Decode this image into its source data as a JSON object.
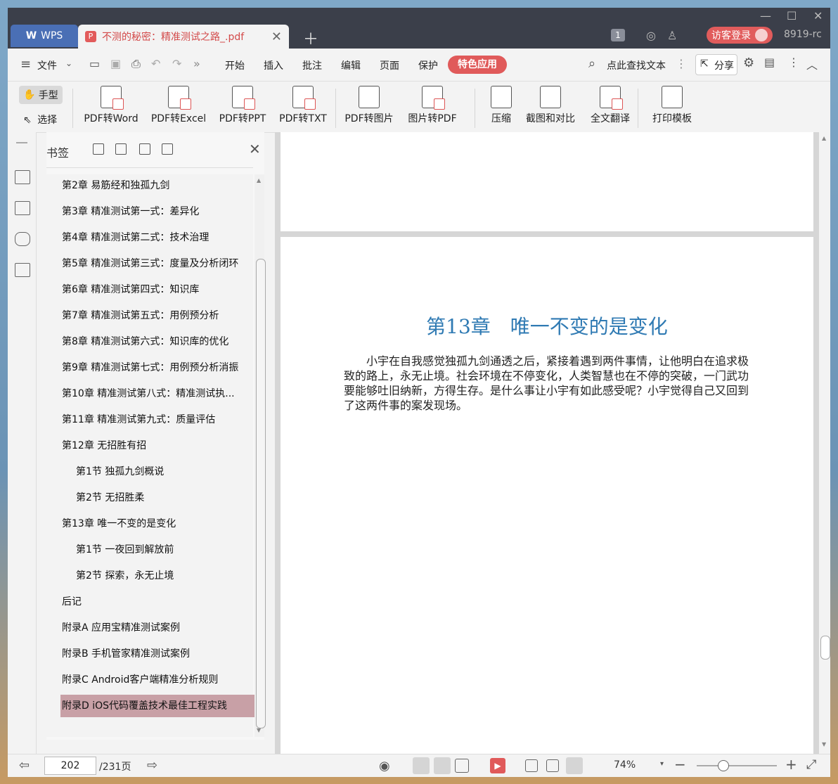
{
  "titlebar": {
    "app_label": "WPS",
    "doc_tab_title": "不测的秘密：精准测试之路_.pdf",
    "page_badge": "1",
    "login_label": "访客登录",
    "version": "8919-rc"
  },
  "menu": {
    "file": "文件",
    "items": [
      "开始",
      "插入",
      "批注",
      "编辑",
      "页面",
      "保护"
    ],
    "special": "特色应用",
    "find": "点此查找文本",
    "share": "分享"
  },
  "ribbon": {
    "hand": "手型",
    "select": "选择",
    "buttons": [
      "PDF转Word",
      "PDF转Excel",
      "PDF转PPT",
      "PDF转TXT",
      "PDF转图片",
      "图片转PDF",
      "压缩",
      "截图和对比",
      "全文翻译",
      "打印模板"
    ]
  },
  "bookmarks": {
    "title": "书签",
    "items": [
      {
        "label": "第2章 易筋经和独孤九剑",
        "level": 1,
        "arrow": "▸"
      },
      {
        "label": "第3章 精准测试第一式：差异化",
        "level": 1,
        "arrow": "▸"
      },
      {
        "label": "第4章 精准测试第二式：技术治理",
        "level": 1,
        "arrow": "▸"
      },
      {
        "label": "第5章 精准测试第三式：度量及分析闭环",
        "level": 1,
        "arrow": "▸"
      },
      {
        "label": "第6章 精准测试第四式：知识库",
        "level": 1,
        "arrow": "▸"
      },
      {
        "label": "第7章 精准测试第五式：用例预分析",
        "level": 1,
        "arrow": "▸"
      },
      {
        "label": "第8章 精准测试第六式：知识库的优化",
        "level": 1,
        "arrow": "▸"
      },
      {
        "label": "第9章 精准测试第七式：用例预分析消振",
        "level": 1,
        "arrow": "▸"
      },
      {
        "label": "第10章 精准测试第八式：精准测试执...",
        "level": 1,
        "arrow": "▸"
      },
      {
        "label": "第11章 精准测试第九式：质量评估",
        "level": 1,
        "arrow": "▸"
      },
      {
        "label": "第12章 无招胜有招",
        "level": 1,
        "arrow": "▴"
      },
      {
        "label": "第1节 独孤九剑概说",
        "level": 2,
        "arrow": ""
      },
      {
        "label": "第2节 无招胜柔",
        "level": 2,
        "arrow": ""
      },
      {
        "label": "第13章 唯一不变的是变化",
        "level": 1,
        "arrow": "▴"
      },
      {
        "label": "第1节 一夜回到解放前",
        "level": 2,
        "arrow": ""
      },
      {
        "label": "第2节 探索，永无止境",
        "level": 2,
        "arrow": ""
      },
      {
        "label": "后记",
        "level": 1,
        "arrow": ""
      },
      {
        "label": "附录A 应用宝精准测试案例",
        "level": 1,
        "arrow": ""
      },
      {
        "label": "附录B 手机管家精准测试案例",
        "level": 1,
        "arrow": ""
      },
      {
        "label": "附录C Android客户端精准分析规则",
        "level": 1,
        "arrow": ""
      },
      {
        "label": "附录D iOS代码覆盖技术最佳工程实践",
        "level": 1,
        "arrow": "",
        "selected": true
      }
    ]
  },
  "document": {
    "chapter_title": "第13章　唯一不变的是变化",
    "paragraph": "小宇在自我感觉独孤九剑通透之后，紧接着遇到两件事情，让他明白在追求极致的路上，永无止境。社会环境在不停变化，人类智慧也在不停的突破，一门武功要能够吐旧纳新，方得生存。是什么事让小宇有如此感受呢？小宇觉得自己又回到了这两件事的案发现场。"
  },
  "status": {
    "current_page": "202",
    "total_pages": "/231页",
    "zoom": "74%"
  },
  "colors": {
    "accent_red": "#e05a5a",
    "chapter_blue": "#2f7ab3",
    "selected_bookmark": "#c8a0a6"
  }
}
